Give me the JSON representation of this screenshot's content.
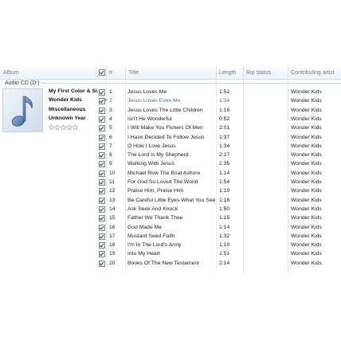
{
  "columns": {
    "album": "Album",
    "num": "#",
    "title": "Title",
    "length": "Length",
    "rip_status": "Rip status",
    "artist": "Contributing artist"
  },
  "group": {
    "label": "Audio CD (D:)"
  },
  "album": {
    "name": "My First Color & Si...",
    "artist": "Wonder Kids",
    "genre": "Miscellaneous",
    "year": "Unknown Year",
    "rating_stars": 0
  },
  "playing_index": 1,
  "tracks": [
    {
      "num": "1",
      "title": "Jesus Loves Me",
      "length": "1:52",
      "artist": "Wonder Kids"
    },
    {
      "num": "2",
      "title": "Jesus Loves Even Me",
      "length": "1:34",
      "artist": "Wonder Kids"
    },
    {
      "num": "3",
      "title": "Jesus Loves The Little Children",
      "length": "1:16",
      "artist": "Wonder Kids"
    },
    {
      "num": "4",
      "title": "Isn't He Wonderful",
      "length": "0:52",
      "artist": "Wonder Kids"
    },
    {
      "num": "5",
      "title": "I Will Make You Fishers Of Men",
      "length": "2:01",
      "artist": "Wonder Kids"
    },
    {
      "num": "6",
      "title": "I Have Decided To Follow Jesus",
      "length": "1:37",
      "artist": "Wonder Kids"
    },
    {
      "num": "7",
      "title": "O How I Love Jesus",
      "length": "1:34",
      "artist": "Wonder Kids"
    },
    {
      "num": "8",
      "title": "The Lord Is My Shepherd",
      "length": "2:27",
      "artist": "Wonder Kids"
    },
    {
      "num": "9",
      "title": "Walking With Jesus",
      "length": "1:35",
      "artist": "Wonder Kids"
    },
    {
      "num": "10",
      "title": "Michael Row The Boat Ashore",
      "length": "1:14",
      "artist": "Wonder Kids"
    },
    {
      "num": "11",
      "title": "For God So Loved The World",
      "length": "1:54",
      "artist": "Wonder Kids"
    },
    {
      "num": "12",
      "title": "Praise Him, Praise Him",
      "length": "1:19",
      "artist": "Wonder Kids"
    },
    {
      "num": "13",
      "title": "Be Careful Little Eyes What You See",
      "length": "1:18",
      "artist": "Wonder Kids"
    },
    {
      "num": "14",
      "title": "Ask Seek And Knock",
      "length": "1:50",
      "artist": "Wonder Kids"
    },
    {
      "num": "15",
      "title": "Father We Thank Thee",
      "length": "1:15",
      "artist": "Wonder Kids"
    },
    {
      "num": "16",
      "title": "God Made Me",
      "length": "1:14",
      "artist": "Wonder Kids"
    },
    {
      "num": "17",
      "title": "Mustard Seed Faith",
      "length": "1:32",
      "artist": "Wonder Kids"
    },
    {
      "num": "18",
      "title": "I'm In The Lord's Army",
      "length": "1:10",
      "artist": "Wonder Kids"
    },
    {
      "num": "19",
      "title": "Into My Heart",
      "length": "1:51",
      "artist": "Wonder Kids"
    },
    {
      "num": "20",
      "title": "Books Of The New Testament",
      "length": "2:14",
      "artist": "Wonder Kids"
    }
  ],
  "colors": {
    "header_text": "#6d7c8c",
    "playing_text": "#3f6fb2",
    "group_text": "#2c3d55"
  }
}
